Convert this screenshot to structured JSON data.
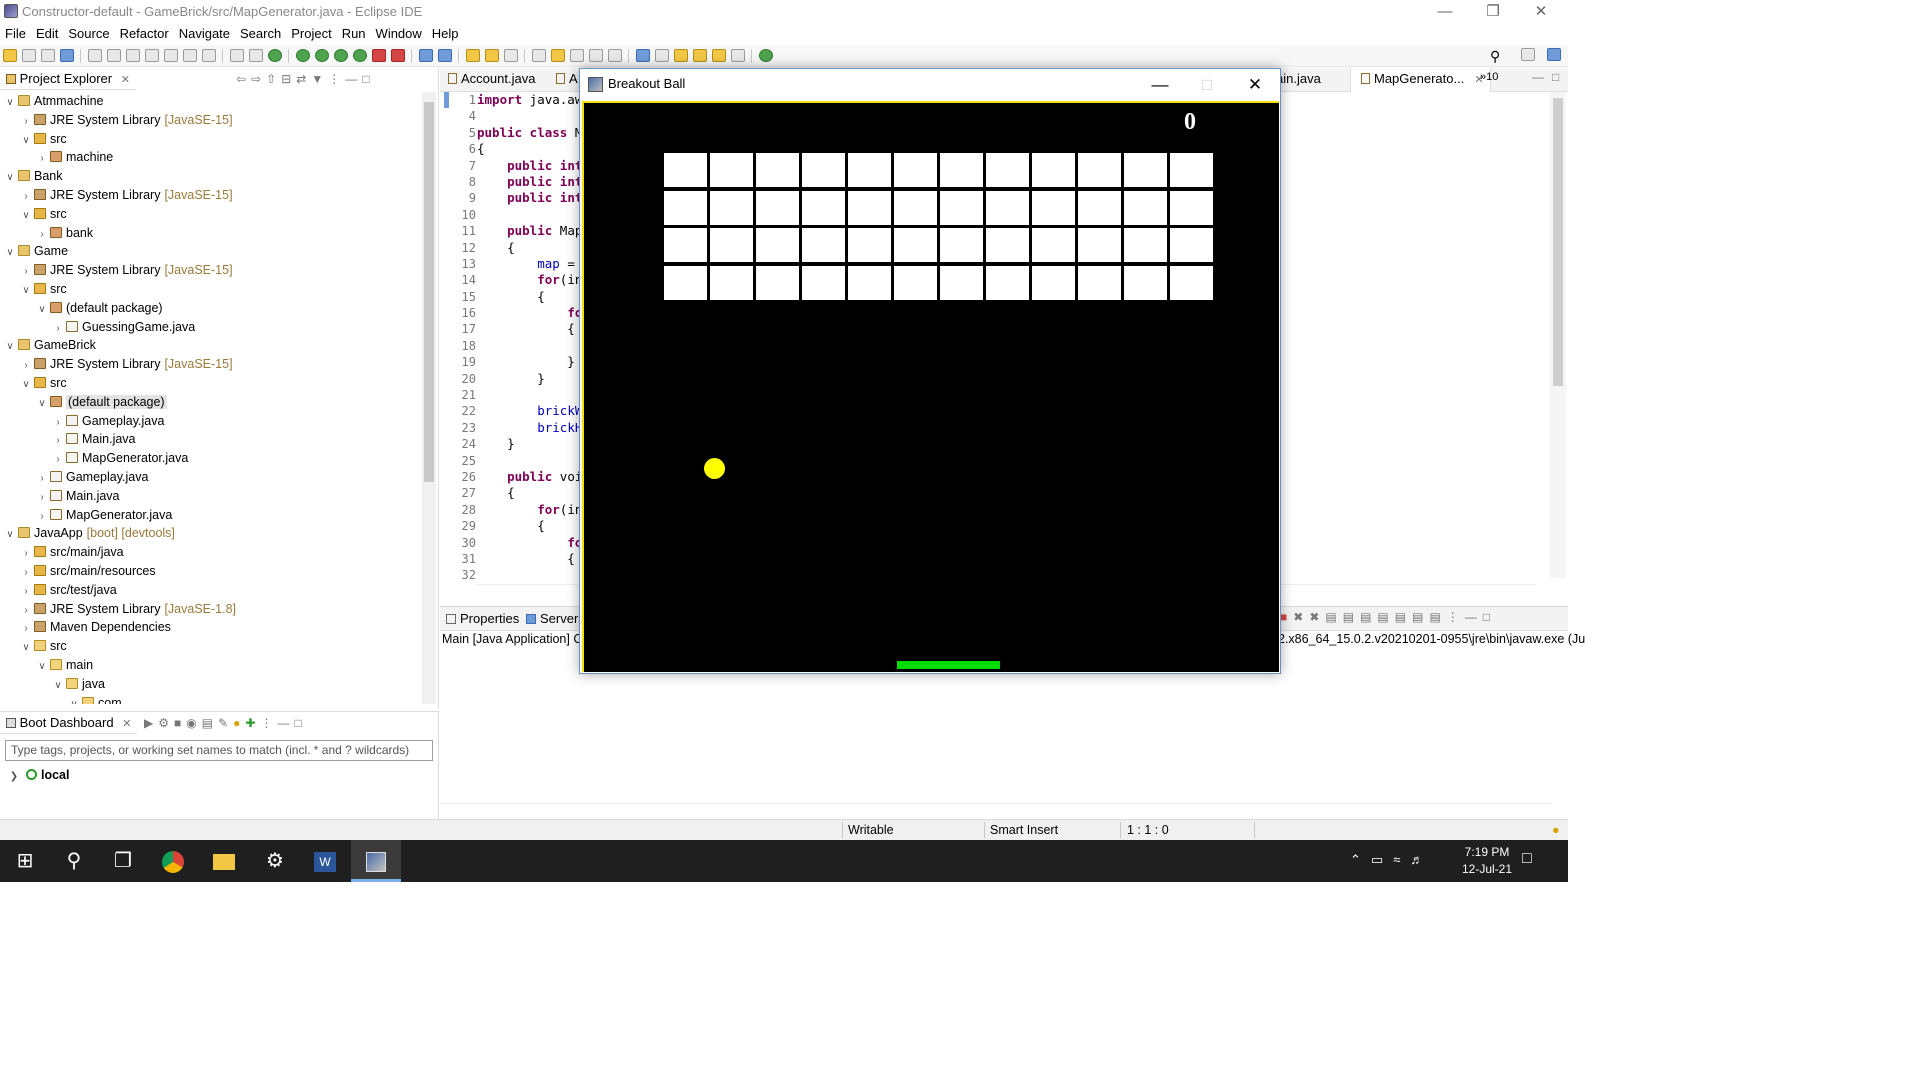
{
  "window": {
    "title": "Constructor-default - GameBrick/src/MapGenerator.java - Eclipse IDE"
  },
  "menu": [
    "File",
    "Edit",
    "Source",
    "Refactor",
    "Navigate",
    "Search",
    "Project",
    "Run",
    "Window",
    "Help"
  ],
  "explorer": {
    "tab_label": "Project Explorer",
    "tree": [
      {
        "label": "Atmmachine",
        "deco": "",
        "indent": 0,
        "chev": "v",
        "icon": "proj"
      },
      {
        "label": "JRE System Library",
        "deco": "[JavaSE-15]",
        "indent": 1,
        "chev": ">",
        "icon": "lib"
      },
      {
        "label": "src",
        "deco": "",
        "indent": 1,
        "chev": "v",
        "icon": "src"
      },
      {
        "label": "machine",
        "deco": "",
        "indent": 2,
        "chev": ">",
        "icon": "pkg"
      },
      {
        "label": "Bank",
        "deco": "",
        "indent": 0,
        "chev": "v",
        "icon": "proj"
      },
      {
        "label": "JRE System Library",
        "deco": "[JavaSE-15]",
        "indent": 1,
        "chev": ">",
        "icon": "lib"
      },
      {
        "label": "src",
        "deco": "",
        "indent": 1,
        "chev": "v",
        "icon": "src"
      },
      {
        "label": "bank",
        "deco": "",
        "indent": 2,
        "chev": ">",
        "icon": "pkg"
      },
      {
        "label": "Game",
        "deco": "",
        "indent": 0,
        "chev": "v",
        "icon": "proj"
      },
      {
        "label": "JRE System Library",
        "deco": "[JavaSE-15]",
        "indent": 1,
        "chev": ">",
        "icon": "lib"
      },
      {
        "label": "src",
        "deco": "",
        "indent": 1,
        "chev": "v",
        "icon": "src"
      },
      {
        "label": "(default package)",
        "deco": "",
        "indent": 2,
        "chev": "v",
        "icon": "pkg"
      },
      {
        "label": "GuessingGame.java",
        "deco": "",
        "indent": 3,
        "chev": ">",
        "icon": "java"
      },
      {
        "label": "GameBrick",
        "deco": "",
        "indent": 0,
        "chev": "v",
        "icon": "proj"
      },
      {
        "label": "JRE System Library",
        "deco": "[JavaSE-15]",
        "indent": 1,
        "chev": ">",
        "icon": "lib"
      },
      {
        "label": "src",
        "deco": "",
        "indent": 1,
        "chev": "v",
        "icon": "src"
      },
      {
        "label": "(default package)",
        "deco": "",
        "indent": 2,
        "chev": "v",
        "icon": "pkg",
        "selected": true
      },
      {
        "label": "Gameplay.java",
        "deco": "",
        "indent": 3,
        "chev": ">",
        "icon": "java"
      },
      {
        "label": "Main.java",
        "deco": "",
        "indent": 3,
        "chev": ">",
        "icon": "java"
      },
      {
        "label": "MapGenerator.java",
        "deco": "",
        "indent": 3,
        "chev": ">",
        "icon": "java"
      },
      {
        "label": "Gameplay.java",
        "deco": "",
        "indent": 2,
        "chev": ">",
        "icon": "java"
      },
      {
        "label": "Main.java",
        "deco": "",
        "indent": 2,
        "chev": ">",
        "icon": "java"
      },
      {
        "label": "MapGenerator.java",
        "deco": "",
        "indent": 2,
        "chev": ">",
        "icon": "java"
      },
      {
        "label": "JavaApp",
        "deco": "[boot] [devtools]",
        "indent": 0,
        "chev": "v",
        "icon": "proj"
      },
      {
        "label": "src/main/java",
        "deco": "",
        "indent": 1,
        "chev": ">",
        "icon": "src"
      },
      {
        "label": "src/main/resources",
        "deco": "",
        "indent": 1,
        "chev": ">",
        "icon": "src"
      },
      {
        "label": "src/test/java",
        "deco": "",
        "indent": 1,
        "chev": ">",
        "icon": "src"
      },
      {
        "label": "JRE System Library",
        "deco": "[JavaSE-1.8]",
        "indent": 1,
        "chev": ">",
        "icon": "lib"
      },
      {
        "label": "Maven Dependencies",
        "deco": "",
        "indent": 1,
        "chev": ">",
        "icon": "lib"
      },
      {
        "label": "src",
        "deco": "",
        "indent": 1,
        "chev": "v",
        "icon": "folder"
      },
      {
        "label": "main",
        "deco": "",
        "indent": 2,
        "chev": "v",
        "icon": "folder"
      },
      {
        "label": "java",
        "deco": "",
        "indent": 3,
        "chev": "v",
        "icon": "folder"
      },
      {
        "label": "com",
        "deco": "",
        "indent": 4,
        "chev": "v",
        "icon": "folder"
      }
    ]
  },
  "boot_dashboard": {
    "tab_label": "Boot Dashboard",
    "filter_placeholder": "Type tags, projects, or working set names to match (incl. * and ? wildcards)",
    "local_label": "local"
  },
  "editor": {
    "tabs": [
      "Account.java",
      "A",
      "ain.java",
      "MapGenerato...",
      "»10"
    ],
    "line_numbers": [
      "1",
      "4",
      "5",
      "6",
      "7",
      "8",
      "9",
      "10",
      "11",
      "12",
      "13",
      "14",
      "15",
      "16",
      "17",
      "18",
      "19",
      "20",
      "21",
      "22",
      "23",
      "24",
      "25",
      "26",
      "27",
      "28",
      "29",
      "30",
      "31",
      "32"
    ],
    "lines": [
      [
        {
          "t": "import",
          "c": "kw"
        },
        {
          "t": " java.aw"
        }
      ],
      [],
      [
        {
          "t": "public class",
          "c": "kw"
        },
        {
          "t": " M"
        }
      ],
      [
        {
          "t": "{"
        }
      ],
      [
        {
          "t": "    "
        },
        {
          "t": "public int",
          "c": "kw"
        }
      ],
      [
        {
          "t": "    "
        },
        {
          "t": "public int",
          "c": "kw"
        }
      ],
      [
        {
          "t": "    "
        },
        {
          "t": "public int",
          "c": "kw"
        }
      ],
      [],
      [
        {
          "t": "    "
        },
        {
          "t": "public",
          "c": "kw"
        },
        {
          "t": " Map"
        }
      ],
      [
        {
          "t": "    {"
        }
      ],
      [
        {
          "t": "        "
        },
        {
          "t": "map",
          "c": "fld"
        },
        {
          "t": " ="
        }
      ],
      [
        {
          "t": "        "
        },
        {
          "t": "for",
          "c": "kw"
        },
        {
          "t": "(in"
        }
      ],
      [
        {
          "t": "        {"
        }
      ],
      [
        {
          "t": "            "
        },
        {
          "t": "fo",
          "c": "kw"
        }
      ],
      [
        {
          "t": "            {"
        }
      ],
      [],
      [
        {
          "t": "            }"
        }
      ],
      [
        {
          "t": "        }"
        }
      ],
      [],
      [
        {
          "t": "        "
        },
        {
          "t": "brickW",
          "c": "fld"
        }
      ],
      [
        {
          "t": "        "
        },
        {
          "t": "brickH",
          "c": "fld"
        }
      ],
      [
        {
          "t": "    }"
        }
      ],
      [],
      [
        {
          "t": "    "
        },
        {
          "t": "public",
          "c": "kw"
        },
        {
          "t": " voi"
        }
      ],
      [
        {
          "t": "    {"
        }
      ],
      [
        {
          "t": "        "
        },
        {
          "t": "for",
          "c": "kw"
        },
        {
          "t": "(in"
        }
      ],
      [
        {
          "t": "        {"
        }
      ],
      [
        {
          "t": "            "
        },
        {
          "t": "fo",
          "c": "kw"
        }
      ],
      [
        {
          "t": "            {"
        }
      ],
      []
    ]
  },
  "console": {
    "tabs": [
      "Properties",
      "Servers"
    ],
    "description": "Main [Java Application] C",
    "path": "2.x86_64_15.0.2.v20210201-0955\\jre\\bin\\javaw.exe  (Ju"
  },
  "status": {
    "writable": "Writable",
    "insert_mode": "Smart Insert",
    "position": "1 : 1 : 0"
  },
  "taskbar": {
    "time": "7:19 PM",
    "date": "12-Jul-21"
  },
  "game": {
    "title": "Breakout Ball",
    "score": "0",
    "brick_rows": 4,
    "brick_cols": 12,
    "ball_color": "#ffff00",
    "paddle_color": "#00dc00",
    "border_color": "#f5e000"
  }
}
